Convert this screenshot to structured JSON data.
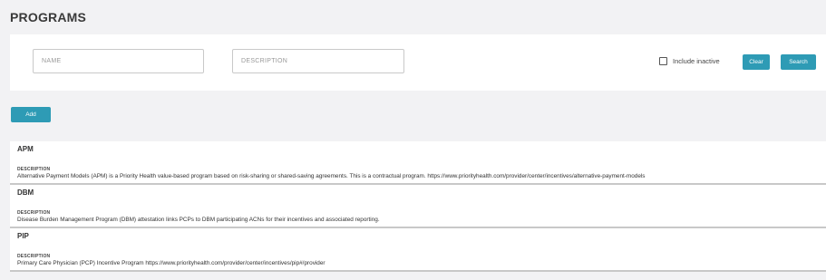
{
  "header": {
    "title": "PROGRAMS"
  },
  "filters": {
    "name_placeholder": "NAME",
    "description_placeholder": "DESCRIPTION",
    "include_inactive_label": "Include inactive",
    "include_inactive_checked": false,
    "clear_label": "Clear",
    "search_label": "Search"
  },
  "actions": {
    "add_label": "Add"
  },
  "programs": [
    {
      "code": "APM",
      "description_heading": "DESCRIPTION",
      "description": "Alternative Payment Models (APM) is a Priority Health value-based program based on risk-sharing or shared-saving agreements. This is a contractual program. https://www.priorityhealth.com/provider/center/incentives/alternative-payment-models"
    },
    {
      "code": "DBM",
      "description_heading": "DESCRIPTION",
      "description": "Disease Burden Management Program (DBM) attestation links PCPs to DBM participating ACNs for their incentives and associated reporting."
    },
    {
      "code": "PIP",
      "description_heading": "DESCRIPTION",
      "description": "Primary Care Physician (PCP) Incentive Program https://www.priorityhealth.com/provider/center/incentives/pip#/provider"
    }
  ],
  "colors": {
    "accent": "#2e9bb5",
    "background": "#f2f2f4",
    "card": "#ffffff"
  }
}
